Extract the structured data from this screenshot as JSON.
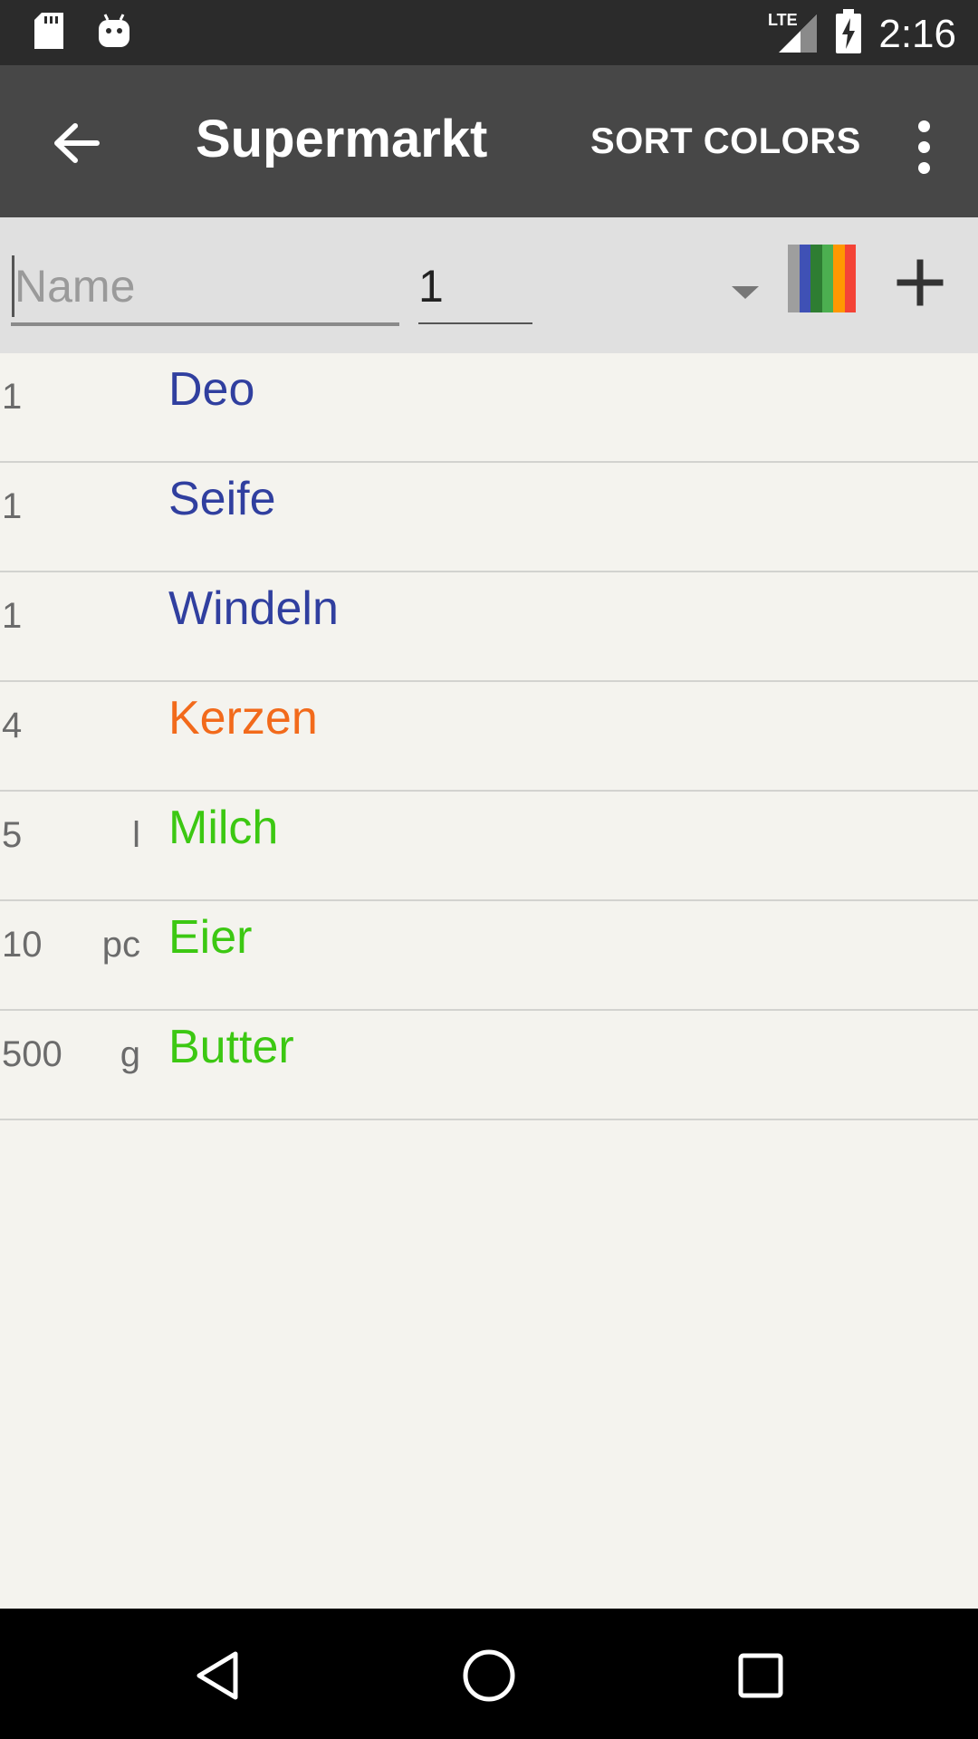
{
  "status_bar": {
    "time": "2:16",
    "network": "LTE",
    "icons": [
      "sd-card-icon",
      "android-icon",
      "lte-signal-icon",
      "battery-charging-icon"
    ]
  },
  "app_bar": {
    "title": "Supermarkt",
    "sort_label": "SORT COLORS",
    "icons": [
      "back-arrow-icon",
      "overflow-menu-icon"
    ]
  },
  "input_bar": {
    "name_placeholder": "Name",
    "name_value": "",
    "quantity_value": "1",
    "unit_selected": "",
    "color_swatches": [
      "#9e9e9e",
      "#3f51b5",
      "#2e7d32",
      "#4caf50",
      "#ff9800",
      "#f44336"
    ],
    "add_icon": "plus-icon"
  },
  "items": [
    {
      "quantity": "1",
      "unit": "",
      "name": "Deo",
      "color": "#303f9f"
    },
    {
      "quantity": "1",
      "unit": "",
      "name": "Seife",
      "color": "#303f9f"
    },
    {
      "quantity": "1",
      "unit": "",
      "name": "Windeln",
      "color": "#303f9f"
    },
    {
      "quantity": "4",
      "unit": "",
      "name": "Kerzen",
      "color": "#f26a1b"
    },
    {
      "quantity": "5",
      "unit": "l",
      "name": "Milch",
      "color": "#3cc812"
    },
    {
      "quantity": "10",
      "unit": "pc",
      "name": "Eier",
      "color": "#3cc812"
    },
    {
      "quantity": "500",
      "unit": "g",
      "name": "Butter",
      "color": "#3cc812"
    }
  ],
  "nav_bar": {
    "icons": [
      "back-triangle-icon",
      "home-circle-icon",
      "recents-square-icon"
    ]
  },
  "colors": {
    "app_bar": "#474747",
    "status_bar": "#2b2b2b",
    "background": "#f4f3ee",
    "input_bar": "#e0e0e0"
  }
}
